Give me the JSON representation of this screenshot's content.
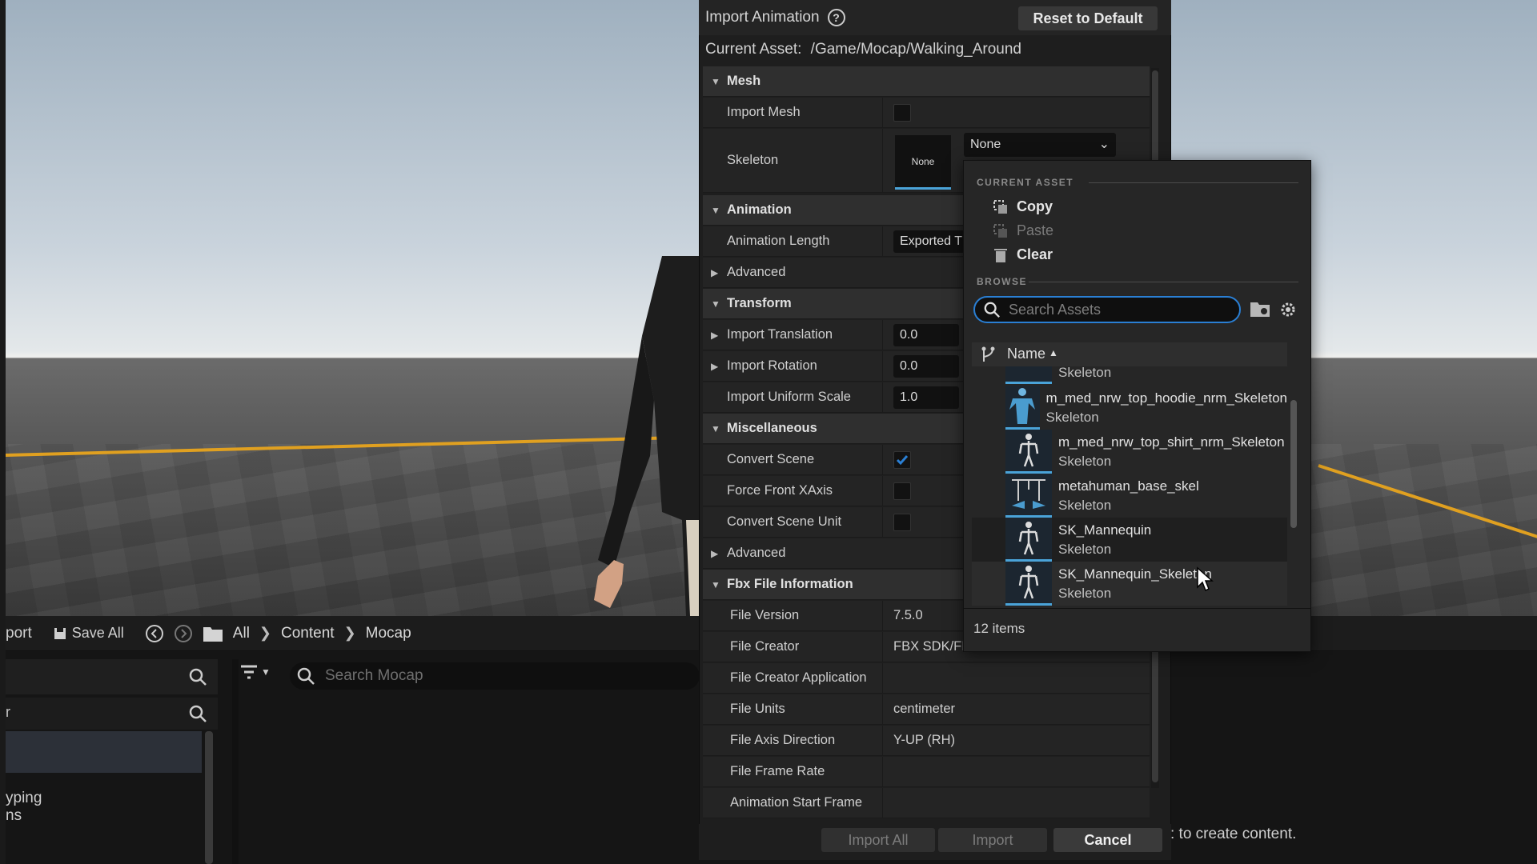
{
  "dialog": {
    "title": "Import Animation",
    "reset_label": "Reset to Default",
    "current_asset_label": "Current Asset:",
    "current_asset_path": "/Game/Mocap/Walking_Around",
    "sections": {
      "mesh": "Mesh",
      "import_mesh": "Import Mesh",
      "skeleton": "Skeleton",
      "skeleton_thumb": "None",
      "skeleton_dropdown": "None",
      "animation": "Animation",
      "animation_length": "Animation Length",
      "animation_length_value": "Exported T",
      "advanced": "Advanced",
      "transform": "Transform",
      "import_translation": "Import Translation",
      "import_translation_value": "0.0",
      "import_rotation": "Import Rotation",
      "import_rotation_value": "0.0",
      "import_uniform_scale": "Import Uniform Scale",
      "import_uniform_scale_value": "1.0",
      "misc": "Miscellaneous",
      "convert_scene": "Convert Scene",
      "force_front_xaxis": "Force Front XAxis",
      "convert_scene_unit": "Convert Scene Unit",
      "advanced2": "Advanced",
      "fbx_info": "Fbx File Information",
      "file_version": "File Version",
      "file_version_value": "7.5.0",
      "file_creator": "File Creator",
      "file_creator_value": "FBX SDK/FI",
      "file_creator_app": "File Creator Application",
      "file_units": "File Units",
      "file_units_value": "centimeter",
      "file_axis_direction": "File Axis Direction",
      "file_axis_direction_value": "Y-UP (RH)",
      "file_frame_rate": "File Frame Rate",
      "animation_start_frame": "Animation Start Frame"
    },
    "footer": {
      "import_all": "Import All",
      "import": "Import",
      "cancel": "Cancel"
    }
  },
  "popup": {
    "current_asset_header": "CURRENT ASSET",
    "copy": "Copy",
    "paste": "Paste",
    "clear": "Clear",
    "browse_header": "BROWSE",
    "search_placeholder": "Search Assets",
    "column_name": "Name",
    "partial_item_type": "Skeleton",
    "assets": [
      {
        "name": "m_med_nrw_top_hoodie_nrm_Skeleton",
        "type": "Skeleton"
      },
      {
        "name": "m_med_nrw_top_shirt_nrm_Skeleton",
        "type": "Skeleton"
      },
      {
        "name": "metahuman_base_skel",
        "type": "Skeleton"
      },
      {
        "name": "SK_Mannequin",
        "type": "Skeleton"
      },
      {
        "name": "SK_Mannequin_Skeleton",
        "type": "Skeleton"
      }
    ],
    "item_count": "12 items"
  },
  "content_browser": {
    "import_partial": "port",
    "save_all": "Save All",
    "breadcrumb": [
      "All",
      "Content",
      "Mocap"
    ],
    "search_placeholder": "Search Mocap",
    "left_partial_1": "r",
    "left_partial_2": "yping",
    "left_partial_3": "ns",
    "hint_text": ": to create content."
  },
  "colors": {
    "accent_blue": "#2a7fd4",
    "checkbox_checked": "#2a7fd4",
    "floor_edge": "#e0a020"
  }
}
